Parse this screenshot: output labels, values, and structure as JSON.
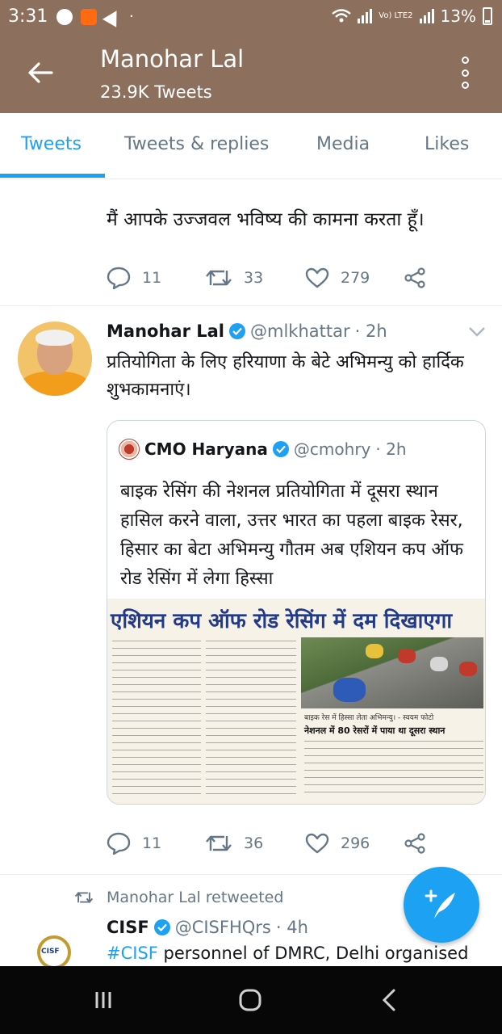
{
  "status_bar": {
    "time": "3:31",
    "network": "Vo) LTE2",
    "battery": "13%"
  },
  "header": {
    "title": "Manohar Lal",
    "subtitle": "23.9K Tweets"
  },
  "tabs": [
    {
      "label": "Tweets",
      "active": true
    },
    {
      "label": "Tweets & replies",
      "active": false
    },
    {
      "label": "Media",
      "active": false
    },
    {
      "label": "Likes",
      "active": false
    }
  ],
  "tweet1": {
    "text": "मैं आपके उज्जवल भविष्य की कामना करता हूँ।",
    "replies": "11",
    "retweets": "33",
    "likes": "279"
  },
  "tweet2": {
    "name": "Manohar Lal",
    "handle": "@mlkhattar",
    "time": "· 2h",
    "text": "प्रतियोगिता के लिए हरियाणा के बेटे अभिमन्यु को हार्दिक शुभकामनाएं।",
    "quoted": {
      "name": "CMO Haryana",
      "handle": "@cmohry",
      "time": "· 2h",
      "text": "बाइक रेसिंग की नेशनल प्रतियोगिता में दूसरा स्थान हासिल करने वाला, उत्तर भारत का पहला बाइक रेसर, हिसार का बेटा अभिमन्यु गौतम अब एशियन कप ऑफ रोड रेसिंग में लेगा हिस्सा",
      "clipping_title": "एशियन कप ऑफ रोड रेसिंग में दम दिखाएगा",
      "clipping_caption": "बाइक रेस में हिस्सा लेता अभिमन्यु। - स्वयम फोटो",
      "clipping_subhead": "नेशनल में 80 रेसरों में पाया था दूसरा स्थान"
    },
    "replies": "11",
    "retweets": "36",
    "likes": "296"
  },
  "retweet_notice": "Manohar Lal retweeted",
  "tweet3": {
    "name": "CISF",
    "handle": "@CISFHQrs",
    "time": "· 4h",
    "hashtag": "#CISF",
    "text": " personnel of DMRC, Delhi organised",
    "avatar_label": "CISF"
  },
  "colors": {
    "header_bg": "#8d6f5d",
    "accent": "#1da1f2",
    "muted": "#657786"
  },
  "icons": [
    "back-arrow-icon",
    "overflow-menu-icon",
    "reply-icon",
    "retweet-icon",
    "like-icon",
    "share-icon",
    "verified-icon",
    "chevron-down-icon",
    "compose-tweet-icon",
    "recents-icon",
    "home-icon",
    "back-nav-icon"
  ]
}
